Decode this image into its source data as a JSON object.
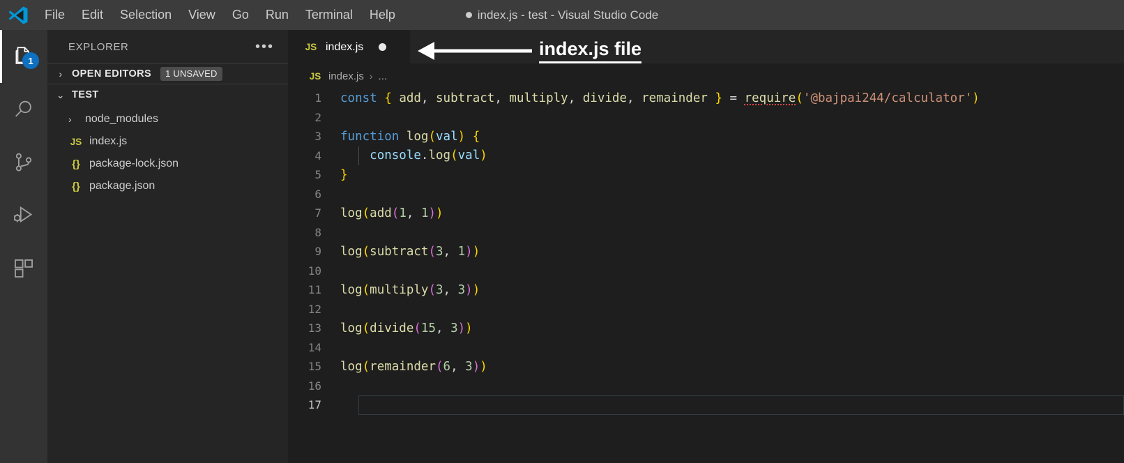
{
  "window": {
    "title": "index.js - test - Visual Studio Code",
    "dirty": true,
    "logo_icon": "vscode-logo-icon"
  },
  "menubar": {
    "items": [
      {
        "label": "File"
      },
      {
        "label": "Edit"
      },
      {
        "label": "Selection"
      },
      {
        "label": "View"
      },
      {
        "label": "Go"
      },
      {
        "label": "Run"
      },
      {
        "label": "Terminal"
      },
      {
        "label": "Help"
      }
    ]
  },
  "activitybar": {
    "items": [
      {
        "name": "explorer",
        "icon": "files-icon",
        "active": true,
        "badge": "1"
      },
      {
        "name": "search",
        "icon": "search-icon",
        "active": false,
        "badge": ""
      },
      {
        "name": "source-control",
        "icon": "source-control-icon",
        "active": false,
        "badge": ""
      },
      {
        "name": "run-and-debug",
        "icon": "run-debug-icon",
        "active": false,
        "badge": ""
      },
      {
        "name": "extensions",
        "icon": "extensions-icon",
        "active": false,
        "badge": ""
      }
    ]
  },
  "sidebar": {
    "title": "EXPLORER",
    "more_actions": "•••",
    "open_editors": {
      "label": "OPEN EDITORS",
      "chevron": "›",
      "badge": "1 UNSAVED"
    },
    "folder": {
      "label": "TEST",
      "chevron": "⌄"
    },
    "files": [
      {
        "name": "node_modules",
        "type": "folder",
        "chevron": "›",
        "icon": ""
      },
      {
        "name": "index.js",
        "type": "file",
        "chevron": "",
        "icon": "JS"
      },
      {
        "name": "package-lock.json",
        "type": "file",
        "chevron": "",
        "icon": "{}"
      },
      {
        "name": "package.json",
        "type": "file",
        "chevron": "",
        "icon": "{}"
      }
    ]
  },
  "editor": {
    "tab": {
      "icon": "JS",
      "label": "index.js",
      "dirty": true
    },
    "breadcrumb": {
      "icon": "JS",
      "file": "index.js",
      "separator": "›",
      "trail": "..."
    },
    "active_line": 17,
    "lines": [
      {
        "n": "1",
        "tokens": [
          {
            "t": "const",
            "c": "kw"
          },
          {
            "t": " ",
            "c": "punc"
          },
          {
            "t": "{",
            "c": "brk1"
          },
          {
            "t": " ",
            "c": "punc"
          },
          {
            "t": "add",
            "c": "fn"
          },
          {
            "t": ", ",
            "c": "punc"
          },
          {
            "t": "subtract",
            "c": "fn"
          },
          {
            "t": ", ",
            "c": "punc"
          },
          {
            "t": "multiply",
            "c": "fn"
          },
          {
            "t": ", ",
            "c": "punc"
          },
          {
            "t": "divide",
            "c": "fn"
          },
          {
            "t": ", ",
            "c": "punc"
          },
          {
            "t": "remainder",
            "c": "fn"
          },
          {
            "t": " ",
            "c": "punc"
          },
          {
            "t": "}",
            "c": "brk1"
          },
          {
            "t": " = ",
            "c": "op"
          },
          {
            "t": "require",
            "c": "fn err"
          },
          {
            "t": "(",
            "c": "brk1"
          },
          {
            "t": "'@bajpai244/calculator'",
            "c": "str"
          },
          {
            "t": ")",
            "c": "brk1"
          }
        ]
      },
      {
        "n": "2",
        "tokens": []
      },
      {
        "n": "3",
        "tokens": [
          {
            "t": "function",
            "c": "kw"
          },
          {
            "t": " ",
            "c": "punc"
          },
          {
            "t": "log",
            "c": "fn"
          },
          {
            "t": "(",
            "c": "brk1"
          },
          {
            "t": "val",
            "c": "var"
          },
          {
            "t": ")",
            "c": "brk1"
          },
          {
            "t": " ",
            "c": "punc"
          },
          {
            "t": "{",
            "c": "brk1"
          }
        ]
      },
      {
        "n": "4",
        "indent": true,
        "tokens": [
          {
            "t": "    ",
            "c": "punc"
          },
          {
            "t": "console",
            "c": "var"
          },
          {
            "t": ".",
            "c": "punc"
          },
          {
            "t": "log",
            "c": "fn"
          },
          {
            "t": "(",
            "c": "brk1"
          },
          {
            "t": "val",
            "c": "var"
          },
          {
            "t": ")",
            "c": "brk1"
          }
        ]
      },
      {
        "n": "5",
        "tokens": [
          {
            "t": "}",
            "c": "brk1"
          }
        ]
      },
      {
        "n": "6",
        "tokens": []
      },
      {
        "n": "7",
        "tokens": [
          {
            "t": "log",
            "c": "fn"
          },
          {
            "t": "(",
            "c": "brk1"
          },
          {
            "t": "add",
            "c": "fn"
          },
          {
            "t": "(",
            "c": "brk2"
          },
          {
            "t": "1",
            "c": "num"
          },
          {
            "t": ", ",
            "c": "punc"
          },
          {
            "t": "1",
            "c": "num"
          },
          {
            "t": ")",
            "c": "brk2"
          },
          {
            "t": ")",
            "c": "brk1"
          }
        ]
      },
      {
        "n": "8",
        "tokens": []
      },
      {
        "n": "9",
        "tokens": [
          {
            "t": "log",
            "c": "fn"
          },
          {
            "t": "(",
            "c": "brk1"
          },
          {
            "t": "subtract",
            "c": "fn"
          },
          {
            "t": "(",
            "c": "brk2"
          },
          {
            "t": "3",
            "c": "num"
          },
          {
            "t": ", ",
            "c": "punc"
          },
          {
            "t": "1",
            "c": "num"
          },
          {
            "t": ")",
            "c": "brk2"
          },
          {
            "t": ")",
            "c": "brk1"
          }
        ]
      },
      {
        "n": "10",
        "tokens": []
      },
      {
        "n": "11",
        "tokens": [
          {
            "t": "log",
            "c": "fn"
          },
          {
            "t": "(",
            "c": "brk1"
          },
          {
            "t": "multiply",
            "c": "fn"
          },
          {
            "t": "(",
            "c": "brk2"
          },
          {
            "t": "3",
            "c": "num"
          },
          {
            "t": ", ",
            "c": "punc"
          },
          {
            "t": "3",
            "c": "num"
          },
          {
            "t": ")",
            "c": "brk2"
          },
          {
            "t": ")",
            "c": "brk1"
          }
        ]
      },
      {
        "n": "12",
        "tokens": []
      },
      {
        "n": "13",
        "tokens": [
          {
            "t": "log",
            "c": "fn"
          },
          {
            "t": "(",
            "c": "brk1"
          },
          {
            "t": "divide",
            "c": "fn"
          },
          {
            "t": "(",
            "c": "brk2"
          },
          {
            "t": "15",
            "c": "num"
          },
          {
            "t": ", ",
            "c": "punc"
          },
          {
            "t": "3",
            "c": "num"
          },
          {
            "t": ")",
            "c": "brk2"
          },
          {
            "t": ")",
            "c": "brk1"
          }
        ]
      },
      {
        "n": "14",
        "tokens": []
      },
      {
        "n": "15",
        "tokens": [
          {
            "t": "log",
            "c": "fn"
          },
          {
            "t": "(",
            "c": "brk1"
          },
          {
            "t": "remainder",
            "c": "fn"
          },
          {
            "t": "(",
            "c": "brk2"
          },
          {
            "t": "6",
            "c": "num"
          },
          {
            "t": ", ",
            "c": "punc"
          },
          {
            "t": "3",
            "c": "num"
          },
          {
            "t": ")",
            "c": "brk2"
          },
          {
            "t": ")",
            "c": "brk1"
          }
        ]
      },
      {
        "n": "16",
        "tokens": []
      },
      {
        "n": "17",
        "tokens": [],
        "current": true
      }
    ]
  },
  "annotation": {
    "text": "index.js file",
    "arrow_direction": "left",
    "color": "#ffffff"
  }
}
